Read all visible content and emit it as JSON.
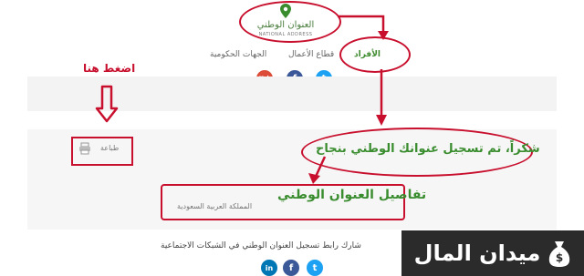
{
  "header": {
    "logo_arabic": "العنوان الوطني",
    "logo_english": "NATIONAL ADDRESS",
    "nav": [
      {
        "label": "الأفراد",
        "active": true
      },
      {
        "label": "قطاع الأعمال",
        "active": false
      },
      {
        "label": "الجهات الحكومية",
        "active": false
      }
    ],
    "social": {
      "gplus": "g+",
      "facebook": "f",
      "twitter": "t"
    }
  },
  "annotation": {
    "press_here": "اضغط هنا"
  },
  "toolbar": {
    "print_label": "طباعة"
  },
  "confirmation": {
    "message": "شكراً، تم تسجيل عنوانك الوطني بنجاح"
  },
  "details": {
    "title": "تفاصيل العنوان الوطني",
    "country": "المملكة العربية السعودية"
  },
  "share": {
    "text": "شارك رابط تسجيل العنوان الوطني في الشبكات الاجتماعية",
    "linkedin": "in",
    "facebook": "f",
    "twitter": "t"
  },
  "watermark": {
    "brand": "ميدان المال",
    "icon": "money-bag-icon"
  },
  "colors": {
    "brand_green": "#3a8d2f",
    "annotation_red": "#c8102e",
    "facebook": "#3b5998",
    "twitter": "#1da1f2",
    "gplus": "#dd4b39",
    "linkedin": "#0077b5"
  }
}
